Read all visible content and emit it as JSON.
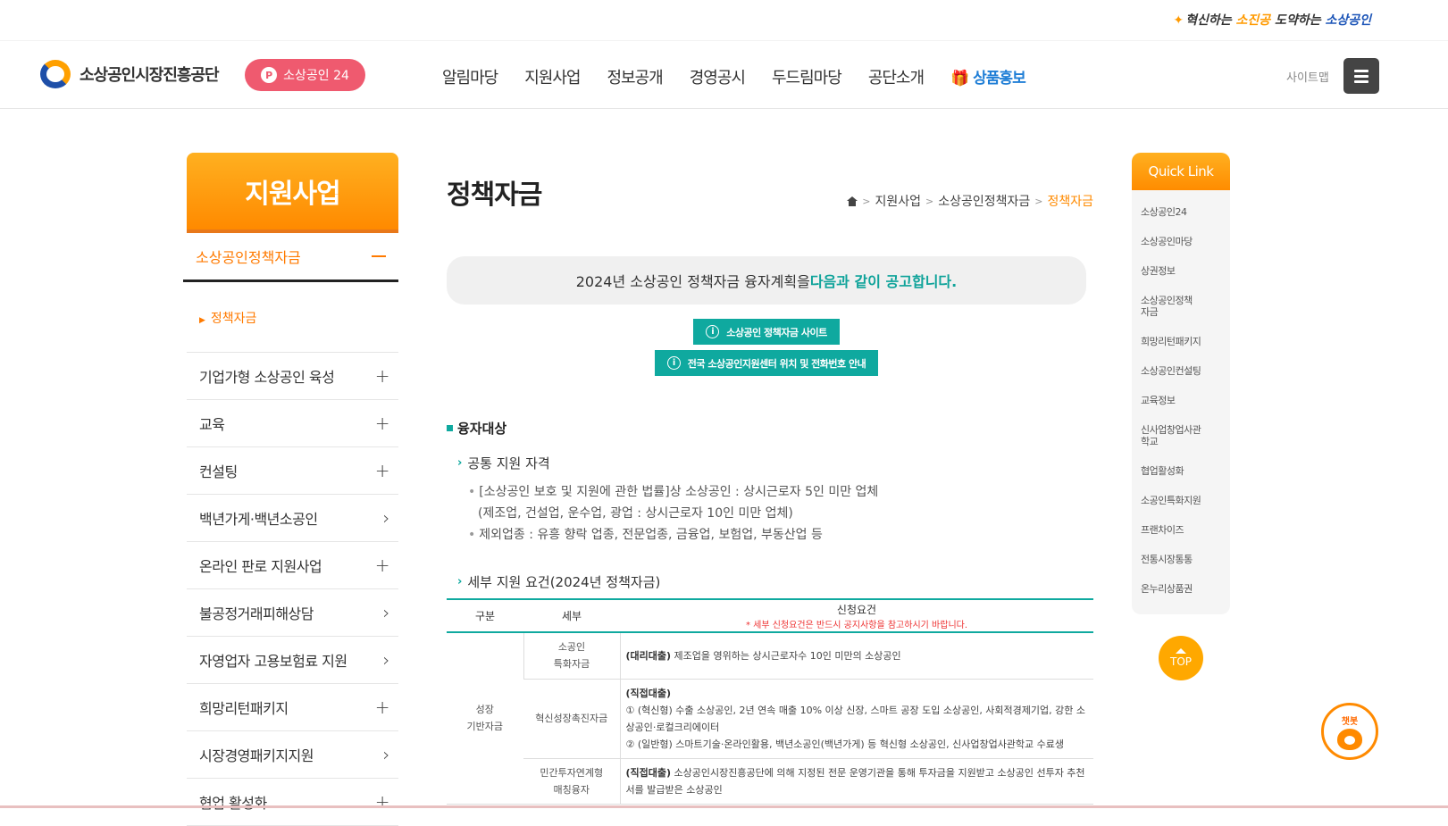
{
  "topbar": {
    "slogan_a": "혁신하는 ",
    "slogan_b": "소진공",
    "slogan_c": " 도약하는 ",
    "slogan_d": "소상공인"
  },
  "header": {
    "logo_text": "소상공인시장진흥공단",
    "sos24": "소상공인 24",
    "nav": [
      "알림마당",
      "지원사업",
      "정보공개",
      "경영공시",
      "두드림마당",
      "공단소개"
    ],
    "promo": "상품홍보",
    "sitemap": "사이트맵"
  },
  "lnb": {
    "title": "지원사업",
    "active": "소상공인정책자금",
    "sub_active": "정책자금",
    "items": [
      {
        "label": "기업가형 소상공인 육성",
        "icon": "+"
      },
      {
        "label": "교육",
        "icon": "+"
      },
      {
        "label": "컨설팅",
        "icon": "+"
      },
      {
        "label": "백년가게·백년소공인",
        "icon": "›"
      },
      {
        "label": "온라인 판로 지원사업",
        "icon": "+"
      },
      {
        "label": "불공정거래피해상담",
        "icon": "›"
      },
      {
        "label": "자영업자 고용보험료 지원",
        "icon": "›"
      },
      {
        "label": "희망리턴패키지",
        "icon": "+"
      },
      {
        "label": "시장경영패키지지원",
        "icon": "›"
      },
      {
        "label": "협업 활성화",
        "icon": "+"
      }
    ]
  },
  "content": {
    "title": "정책자금",
    "breadcrumb": [
      "지원사업",
      "소상공인정책자금",
      "정책자금"
    ],
    "notice_a": "2024년 소상공인 정책자금 융자계획을 ",
    "notice_b": "다음과 같이 공고합니다.",
    "btn1": "소상공인 정책자금 사이트",
    "btn2": "전국 소상공인지원센터 위치 및 전화번호 안내",
    "section": "융자대상",
    "sub1": "공통 지원 자격",
    "bullet1": "[소상공인 보호 및 지원에 관한 법률]상 소상공인 : 상시근로자 5인 미만 업체",
    "bullet1_cont": "(제조업, 건설업, 운수업, 광업 : 상시근로자 10인 미만 업체)",
    "bullet2": "제외업종 : 유흥 향락 업종, 전문업종, 금융업, 보험업, 부동산업 등",
    "sub2": "세부 지원 요건(2024년 정책자금)",
    "table": {
      "h1": "구분",
      "h2": "세부",
      "h3": "신청요건",
      "h3_warn": "* 세부 신청요건은 반드시 공지사항을 참고하시기 바랍니다.",
      "group": "성장\n기반자금",
      "r1_name": "소공인\n특화자금",
      "r1_tag": "(대리대출)",
      "r1_text": " 제조업을 영위하는 상시근로자수 10인 미만의 소상공인",
      "r2_name": "혁신성장촉진자금",
      "r2_tag": "(직접대출)",
      "r2_l1": "① (혁신형) 수출 소상공인, 2년 연속 매출 10% 이상 신장, 스마트 공장 도입 소상공인, 사회적경제기업, 강한 소상공인·로컬크리에이터",
      "r2_l2": "② (일반형) 스마트기술·온라인활용, 백년소공인(백년가게) 등 혁신형 소상공인, 신사업창업사관학교 수료생",
      "r3_name": "민간투자연계형\n매칭융자",
      "r3_tag": "(직접대출)",
      "r3_text": " 소상공인시장진흥공단에 의해 지정된 전문 운영기관을 통해 투자금을 지원받고 소상공인 선투자 추천서를 발급받은 소상공인"
    }
  },
  "quick": {
    "title": "Quick Link",
    "items": [
      "소상공인24",
      "소상공인마당",
      "상권정보",
      "소상공인정책\n자금",
      "희망리턴패키지",
      "소상공인컨설팅",
      "교육정보",
      "신사업창업사관\n학교",
      "협업활성화",
      "소공인특화지원",
      "프랜차이즈",
      "전통시장통통",
      "온누리상품권"
    ]
  },
  "top_btn": "TOP",
  "chatbot": "챗봇",
  "colors": {
    "orange": "#ff8a00",
    "teal": "#0fa99f",
    "pink": "#ef5a6f",
    "promo": "#1f7ed6"
  }
}
